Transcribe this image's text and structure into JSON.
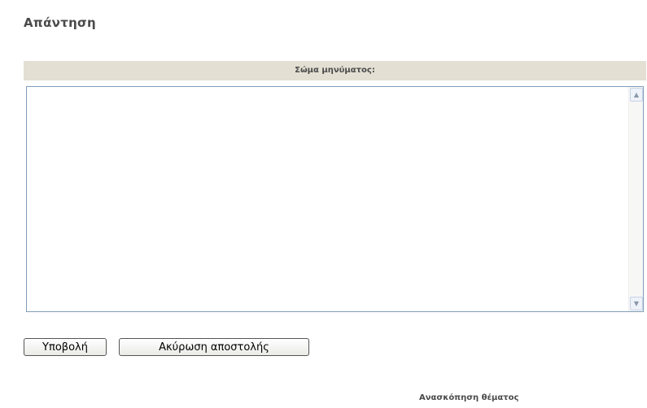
{
  "page": {
    "title": "Απάντηση"
  },
  "form": {
    "message_label": "Σώμα μηνύματος:",
    "message_value": "",
    "scroll_up_icon": "scroll-up-arrow",
    "scroll_down_icon": "scroll-down-arrow"
  },
  "buttons": {
    "submit_label": "Υποβολή",
    "cancel_label": "Ακύρωση αποστολής"
  },
  "footer": {
    "topic_review": "Ανασκόπηση θέματος"
  },
  "colors": {
    "header_bg": "#e3e0d3",
    "input_border": "#7f9db9",
    "text": "#4a4a4a"
  }
}
